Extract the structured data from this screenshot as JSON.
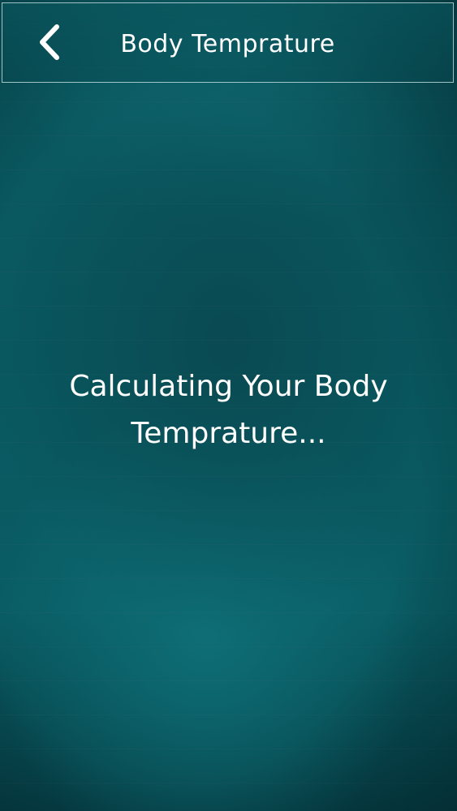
{
  "header": {
    "title": "Body Temprature",
    "back_icon": "chevron-left-icon"
  },
  "main": {
    "message": "Calculating Your Body Temprature..."
  },
  "colors": {
    "background": "#0a5c64",
    "text": "#ffffff",
    "header_border": "#d2ebee"
  }
}
